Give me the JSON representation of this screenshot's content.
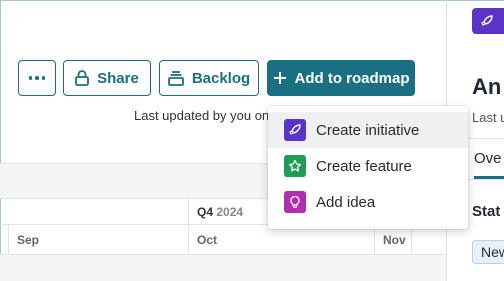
{
  "toolbar": {
    "more_label": "More options",
    "share_label": "Share",
    "backlog_label": "Backlog",
    "add_label": "Add to roadmap"
  },
  "last_updated": "Last updated by you on",
  "timeline": {
    "quarter": "Q4",
    "year": "2024",
    "months": [
      "Sep",
      "Oct",
      "Nov"
    ]
  },
  "menu": {
    "items": [
      {
        "label": "Create initiative",
        "icon": "rocket-icon",
        "color": "#5b33c6"
      },
      {
        "label": "Create feature",
        "icon": "star-icon",
        "color": "#1f9d55"
      },
      {
        "label": "Add idea",
        "icon": "lightbulb-icon",
        "color": "#b02fb1"
      }
    ]
  },
  "right_panel": {
    "title": "An",
    "subtitle": "Last u",
    "tab": "Ove",
    "status_heading": "Stat",
    "status_value": "New"
  },
  "colors": {
    "primary": "#1b6f82",
    "initiative": "#5b33c6",
    "feature": "#1f9d55",
    "idea": "#b02fb1"
  }
}
